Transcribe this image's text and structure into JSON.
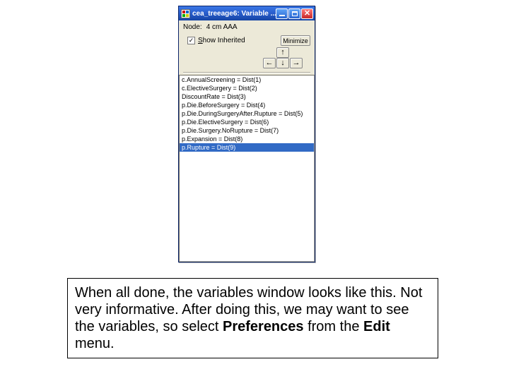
{
  "window": {
    "title": "cea_treeage6: Variable ...",
    "node_label": "Node:",
    "node_value": "4 cm AAA",
    "show_inherited_label_pre": "S",
    "show_inherited_label_post": "how Inherited",
    "show_inherited_checked": "✓",
    "minimize_btn": "Minimize",
    "arrows": {
      "up": "↑",
      "down": "↓",
      "left": "←",
      "right": "→"
    }
  },
  "variables": [
    "c.AnnualScreening = Dist(1)",
    "c.ElectiveSurgery = Dist(2)",
    "DiscountRate = Dist(3)",
    "p.Die.BeforeSurgery = Dist(4)",
    "p.Die.DuringSurgeryAfter.Rupture = Dist(5)",
    "p.Die.ElectiveSurgery = Dist(6)",
    "p.Die.Surgery.NoRupture = Dist(7)",
    "p.Expansion = Dist(8)",
    "p.Rupture = Dist(9)"
  ],
  "caption": {
    "t1": "When all done, the variables window looks like",
    "t2": "this. Not very informative. After doing this, we",
    "t3": "may want to see the variables, so select",
    "pref": "Preferences",
    "t4": " from the ",
    "edit": "Edit",
    "t5": " menu."
  }
}
